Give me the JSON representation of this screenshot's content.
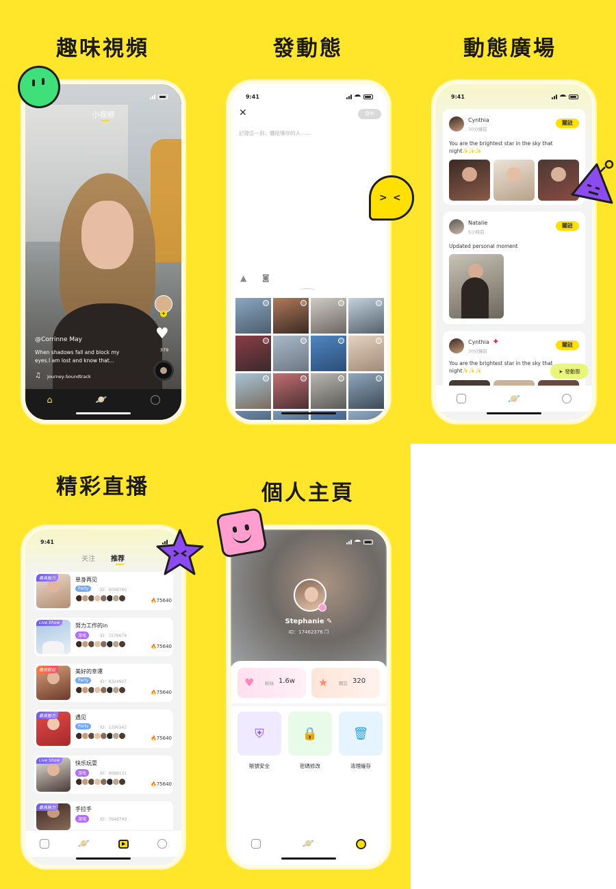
{
  "headings": {
    "video": "趣味視頻",
    "post": "發動態",
    "plaza": "動態廣場",
    "live": "精彩直播",
    "profile": "個人主頁"
  },
  "status_time": "9:41",
  "video_screen": {
    "tab_title": "小视频",
    "username": "@Corrinne May",
    "caption_line1": "When shadows fall and block my",
    "caption_line2": "eyes.I am lost and know that...",
    "music": "Journey-Soundtrack",
    "likes": "379"
  },
  "post_screen": {
    "publish_label": "發布",
    "placeholder": "記錄這一刻，曬給懂你的人......"
  },
  "plaza_screen": {
    "posts": [
      {
        "name": "Cynthia",
        "time": "30分鐘前",
        "follow": "關註",
        "text_line1": "You are the brightest star in the sky that",
        "text_line2": "night✨✨✨"
      },
      {
        "name": "Natalie",
        "time": "5小時前",
        "follow": "關註",
        "text_line1": "Updated personal moment",
        "text_line2": ""
      },
      {
        "name": "Cynthia",
        "time": "30分鐘前",
        "follow": "關註",
        "text_line1": "You are the brightest star in the sky that",
        "text_line2": "night✨✨✨"
      }
    ],
    "post_button": "發動態"
  },
  "live_screen": {
    "tabs": [
      "关注",
      "推荐"
    ],
    "rooms": [
      {
        "title": "单身再见",
        "badge": "最具魅力",
        "chip": "Party",
        "id": "ID：9098760",
        "hot": "75640"
      },
      {
        "title": "努力工作的in",
        "badge": "Live Show",
        "chip": "游戏",
        "id": "ID：7578679",
        "hot": "75640"
      },
      {
        "title": "美好的幸運",
        "badge": "最受歡迎",
        "chip": "Party",
        "id": "ID：8324907",
        "hot": "75640"
      },
      {
        "title": "遇见",
        "badge": "最具魅力",
        "chip": "Party",
        "id": "ID：1290342",
        "hot": "75640"
      },
      {
        "title": "快乐玩耍",
        "badge": "Live Show",
        "chip": "游戏",
        "id": "ID：9088131",
        "hot": "75640"
      },
      {
        "title": "手拉手",
        "badge": "最具魅力",
        "chip": "游戏",
        "id": "ID：7648749",
        "hot": ""
      }
    ]
  },
  "profile_screen": {
    "name": "Stephanie",
    "id": "ID：17462376",
    "fans_label": "粉絲",
    "fans_value": "1.6w",
    "follow_label": "關註",
    "follow_value": "320",
    "tools": [
      "賬號安全",
      "密碼修改",
      "清理緩存"
    ]
  },
  "colors": {
    "brand_yellow": "#FFE62A",
    "follow_yellow": "#FFE000",
    "sticker_green": "#3FE07A",
    "sticker_purple": "#8B4BF0",
    "sticker_pink": "#FF9ECF"
  }
}
